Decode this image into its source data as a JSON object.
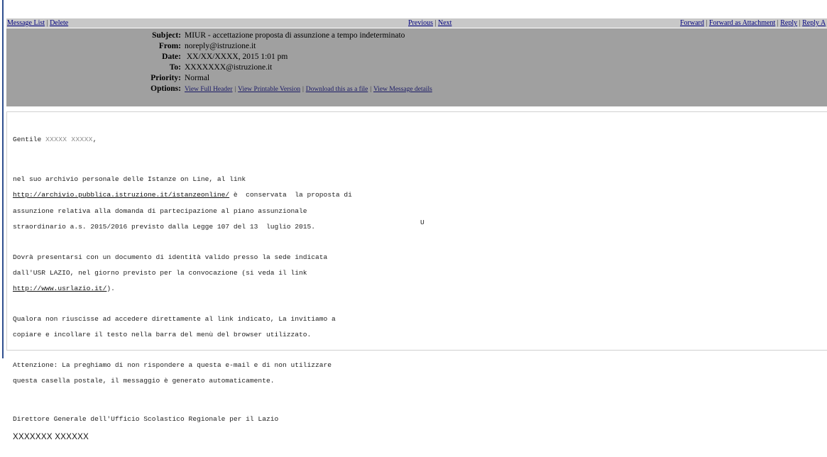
{
  "nav": {
    "message_list": "Message List",
    "delete": "Delete",
    "previous": "Previous",
    "next": "Next",
    "forward": "Forward",
    "forward_attachment": "Forward as Attachment",
    "reply": "Reply",
    "reply_all": "Reply A",
    "separator": "|"
  },
  "header": {
    "subject_label": "Subject:",
    "subject": "MIUR - accettazione proposta di assunzione a tempo indeterminato",
    "from_label": "From:",
    "from": "noreply@istruzione.it",
    "date_label": "Date:",
    "date": " XX/XX/XXXX, 2015 1:01 pm",
    "to_label": "To:",
    "to": "XXXXXXX@istruzione.it",
    "priority_label": "Priority:",
    "priority": "Normal",
    "options_label": "Options:",
    "options": [
      "View Full Header",
      "View Printable Version",
      "Download this as a file",
      "View Message details"
    ]
  },
  "message": {
    "greeting": "Gentile ",
    "greeting_name": "XXXXX XXXXX",
    "greeting_end": ",",
    "p1_line1": "nel suo archivio personale delle Istanze on Line, al link",
    "p1_link": "http://archivio.pubblica.istruzione.it/istanzeonline/",
    "p1_line2_rest": " è  conservata  la proposta di",
    "p1_line3": "assunzione relativa alla domanda di partecipazione al piano assunzionale",
    "p1_line4": "straordinario a.s. 2015/2016 previsto dalla Legge 107 del 13  luglio 2015.",
    "p2_line1": "Dovrà presentarsi con un documento di identità valido presso la sede indicata",
    "p2_line2": "dall'USR LAZIO, nel giorno previsto per la convocazione (si veda il link",
    "p2_link": "http://www.usrlazio.it/",
    "p2_line3_rest": ").",
    "stray_char": "U",
    "p3_line1": "Qualora non riuscisse ad accedere direttamente al link indicato, La invitiamo a",
    "p3_line2": "copiare e incollare il testo nella barra del menù del browser utilizzato.",
    "p4_line1": "Attenzione: La preghiamo di non rispondere a questa e-mail e di non utilizzare",
    "p4_line2": "questa casella postale, il messaggio è generato automaticamente.",
    "signature_title": "Direttore Generale dell'Ufficio Scolastico Regionale per il Lazio",
    "signature_name": "XXXXXXX XXXXXX"
  }
}
